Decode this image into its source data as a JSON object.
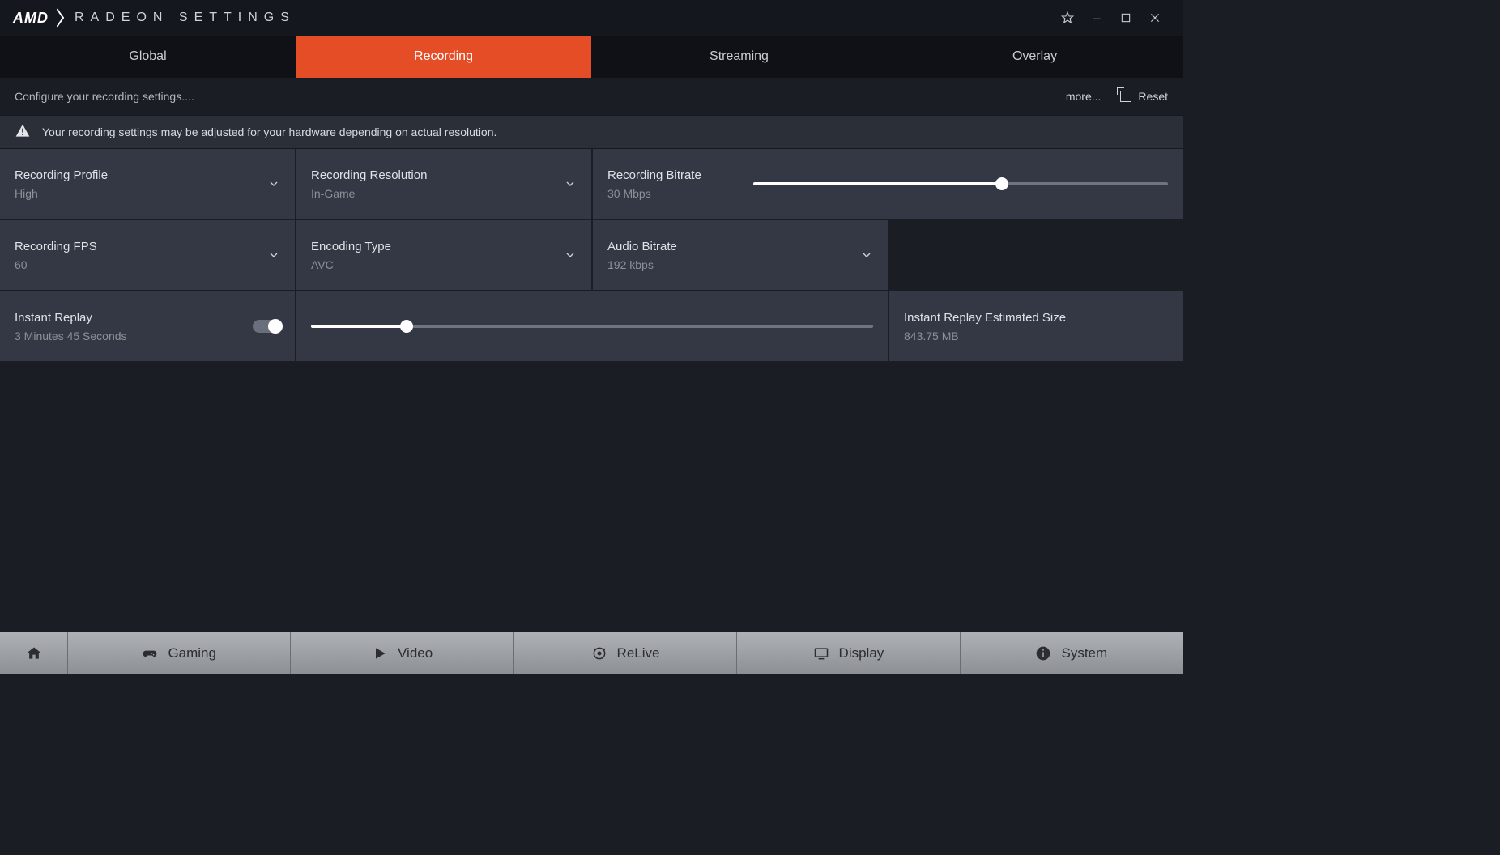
{
  "header": {
    "brand": "AMD",
    "app_title": "RADEON SETTINGS"
  },
  "top_tabs": {
    "global": "Global",
    "recording": "Recording",
    "streaming": "Streaming",
    "overlay": "Overlay",
    "active": "recording"
  },
  "subheader": {
    "text": "Configure your recording settings....",
    "more": "more...",
    "reset": "Reset"
  },
  "info_strip": "Your recording settings may be adjusted for your hardware depending on actual resolution.",
  "tiles": {
    "recording_profile": {
      "label": "Recording Profile",
      "value": "High"
    },
    "recording_resolution": {
      "label": "Recording Resolution",
      "value": "In-Game"
    },
    "recording_bitrate": {
      "label": "Recording Bitrate",
      "value": "30 Mbps",
      "slider_percent": 60
    },
    "recording_fps": {
      "label": "Recording FPS",
      "value": "60"
    },
    "encoding_type": {
      "label": "Encoding Type",
      "value": "AVC"
    },
    "audio_bitrate": {
      "label": "Audio Bitrate",
      "value": "192 kbps"
    },
    "instant_replay": {
      "label": "Instant Replay",
      "value": "3 Minutes 45 Seconds",
      "slider_percent": 17
    },
    "instant_replay_size": {
      "label": "Instant Replay Estimated Size",
      "value": "843.75 MB"
    }
  },
  "bottom_nav": {
    "gaming": "Gaming",
    "video": "Video",
    "relive": "ReLive",
    "display": "Display",
    "system": "System"
  }
}
